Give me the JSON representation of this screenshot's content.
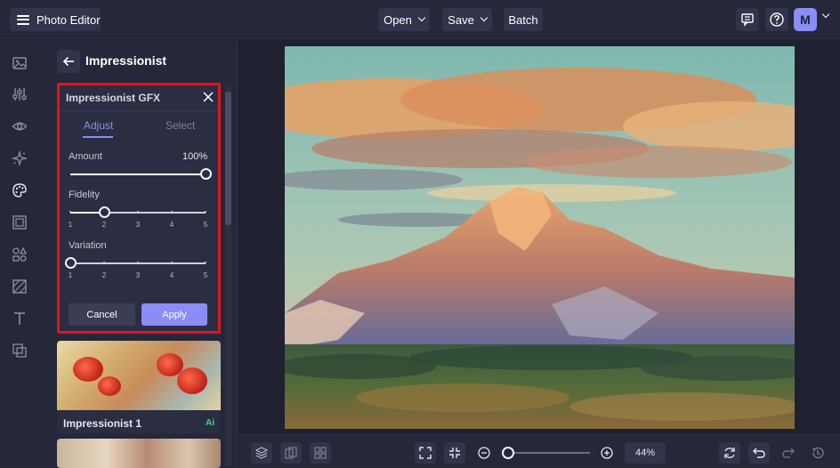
{
  "topbar": {
    "app_title": "Photo Editor",
    "open_label": "Open",
    "save_label": "Save",
    "batch_label": "Batch",
    "avatar_initial": "M"
  },
  "panel": {
    "title": "Impressionist",
    "card": {
      "title": "Impressionist GFX",
      "tabs": [
        {
          "label": "Adjust",
          "active": true
        },
        {
          "label": "Select",
          "active": false
        }
      ],
      "amount": {
        "label": "Amount",
        "value_text": "100%",
        "value": 100
      },
      "fidelity": {
        "label": "Fidelity",
        "value": 2,
        "ticks": [
          "1",
          "2",
          "3",
          "4",
          "5"
        ]
      },
      "variation": {
        "label": "Variation",
        "value": 1,
        "ticks": [
          "1",
          "2",
          "3",
          "4",
          "5"
        ]
      },
      "cancel_label": "Cancel",
      "apply_label": "Apply"
    },
    "presets": [
      {
        "name": "Impressionist 1",
        "badge": "Ai"
      }
    ]
  },
  "bottombar": {
    "zoom_text": "44%",
    "zoom_value": 44
  },
  "icons": {
    "left_rail": [
      "image-icon",
      "sliders-icon",
      "eye-icon",
      "sparkle-icon",
      "palette-icon",
      "frame-icon",
      "shapes-icon",
      "texture-icon",
      "text-icon",
      "overlay-icon"
    ]
  },
  "colors": {
    "accent": "#8b8cf4",
    "highlight_border": "#e0141e",
    "ai_badge": "#3bd68b"
  }
}
